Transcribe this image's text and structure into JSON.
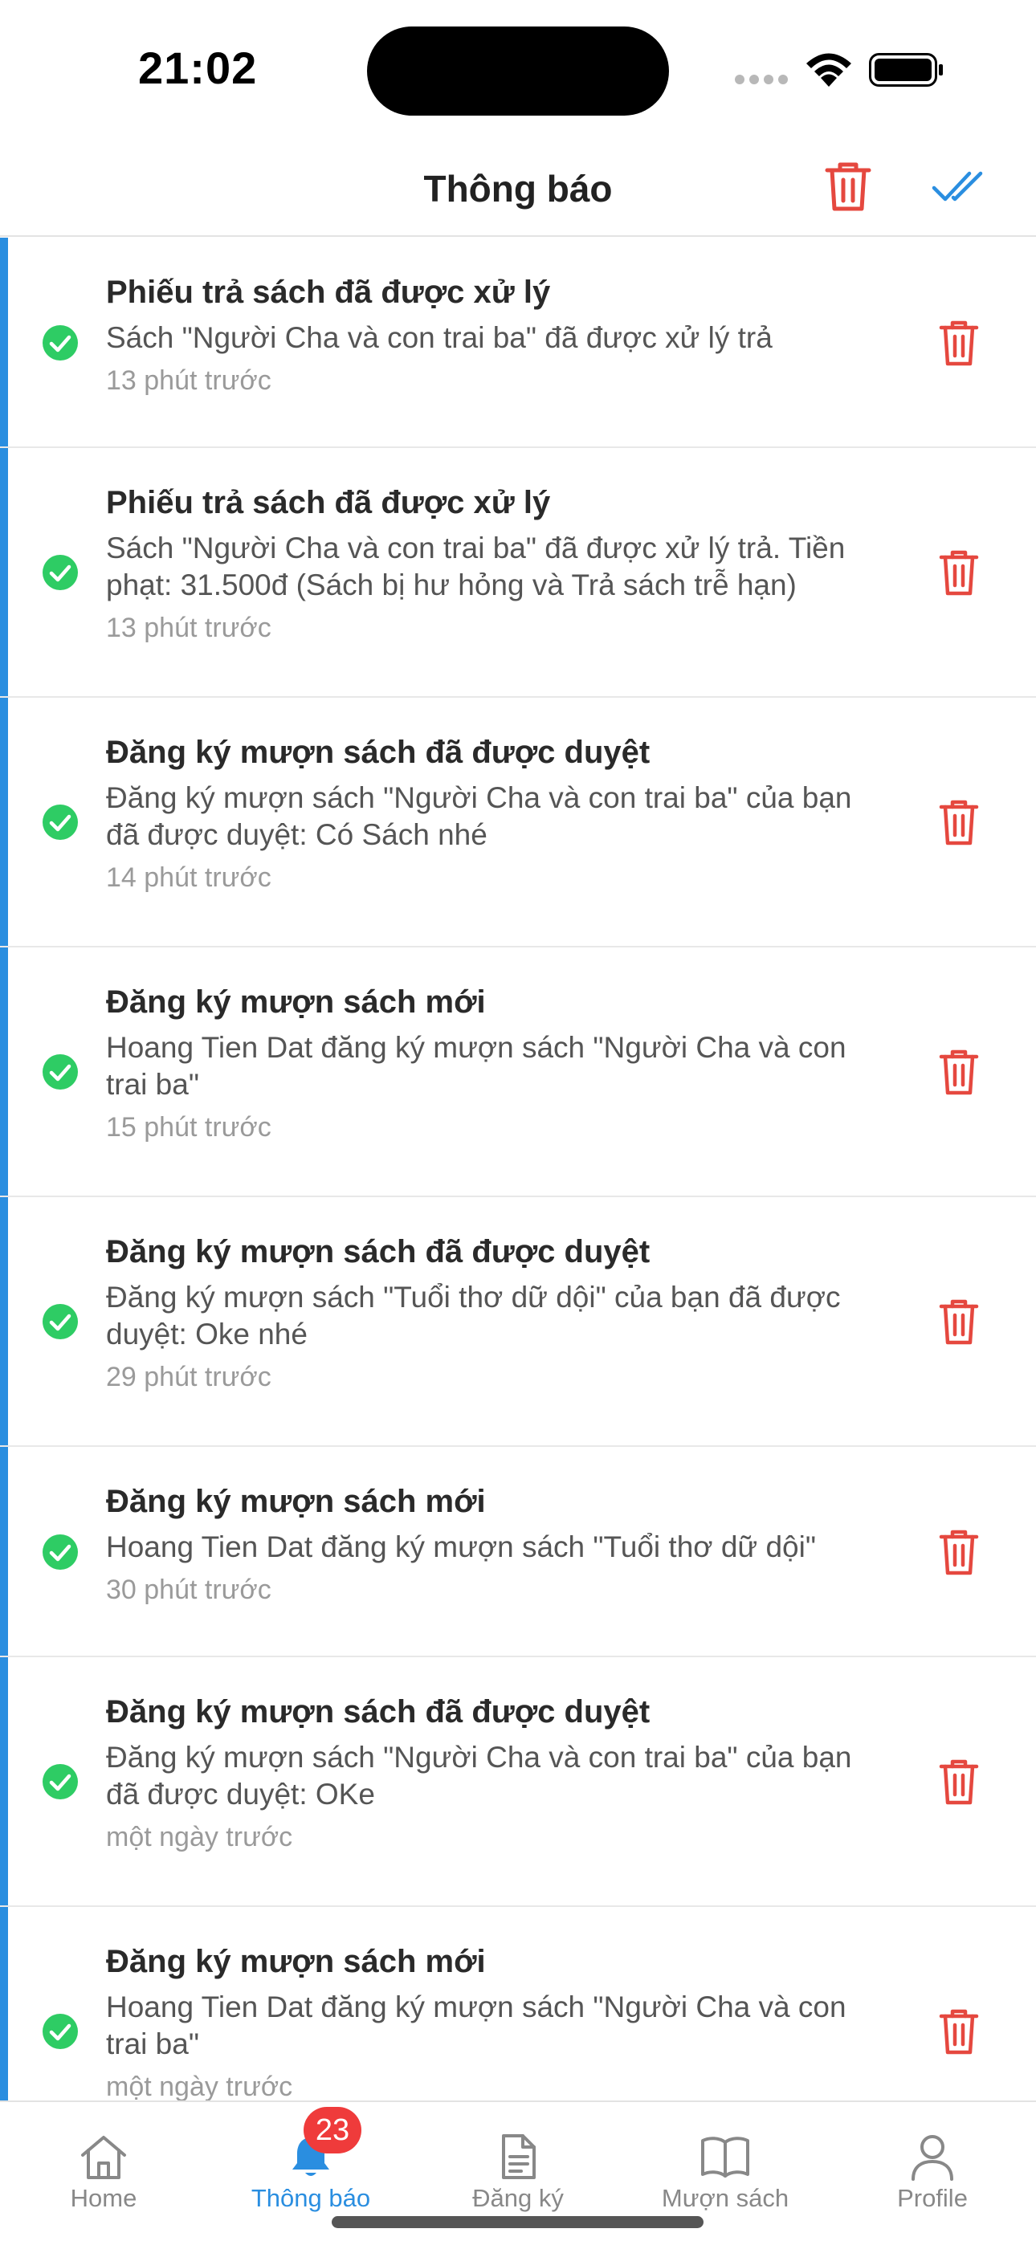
{
  "status_bar": {
    "time": "21:02"
  },
  "header": {
    "title": "Thông báo"
  },
  "colors": {
    "accent": "#2a8ee0",
    "danger": "#e5483f",
    "success": "#2ecc64",
    "badge": "#ef3b3b"
  },
  "notifications": [
    {
      "title": "Phiếu trả sách đã được xử lý",
      "message": "Sách \"Người Cha và con trai ba\" đã được xử lý trả",
      "time": "13 phút trước"
    },
    {
      "title": "Phiếu trả sách đã được xử lý",
      "message": "Sách \"Người Cha và con trai ba\" đã được xử lý trả. Tiền phạt: 31.500đ (Sách bị hư hỏng và Trả sách trễ hạn)",
      "time": "13 phút trước"
    },
    {
      "title": "Đăng ký mượn sách đã được duyệt",
      "message": "Đăng ký mượn sách \"Người Cha và con trai ba\" của bạn đã được duyệt: Có Sách nhé",
      "time": "14 phút trước"
    },
    {
      "title": "Đăng ký mượn sách mới",
      "message": "Hoang Tien Dat đăng ký mượn sách \"Người Cha và con trai ba\"",
      "time": "15 phút trước"
    },
    {
      "title": "Đăng ký mượn sách đã được duyệt",
      "message": "Đăng ký mượn sách \"Tuổi thơ dữ dội\" của bạn đã được duyệt: Oke nhé",
      "time": "29 phút trước"
    },
    {
      "title": "Đăng ký mượn sách mới",
      "message": "Hoang Tien Dat đăng ký mượn sách \"Tuổi thơ dữ dội\"",
      "time": "30 phút trước"
    },
    {
      "title": "Đăng ký mượn sách đã được duyệt",
      "message": "Đăng ký mượn sách \"Người Cha và con trai ba\" của bạn đã được duyệt: OKe",
      "time": "một ngày trước"
    },
    {
      "title": "Đăng ký mượn sách mới",
      "message": "Hoang Tien Dat đăng ký mượn sách \"Người Cha và con trai ba\"",
      "time": "một ngày trước"
    }
  ],
  "tabs": [
    {
      "label": "Home",
      "icon": "home-icon"
    },
    {
      "label": "Thông báo",
      "icon": "bell-icon",
      "badge": "23"
    },
    {
      "label": "Đăng ký",
      "icon": "document-icon"
    },
    {
      "label": "Mượn sách",
      "icon": "book-icon"
    },
    {
      "label": "Profile",
      "icon": "user-icon"
    }
  ]
}
